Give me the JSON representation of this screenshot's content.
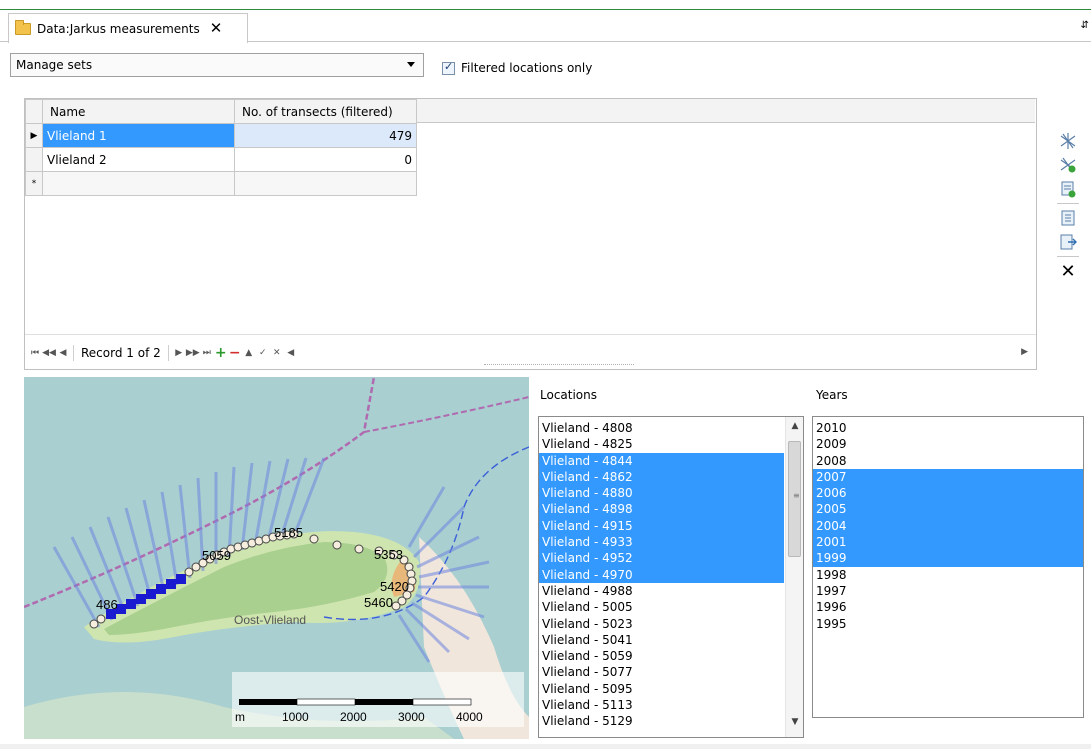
{
  "tab": {
    "title": "Data:Jarkus measurements",
    "close_icon": "close-icon"
  },
  "toolbar": {
    "combo_value": "Manage sets",
    "filter_checkbox_label": "Filtered locations only",
    "filter_checked": true
  },
  "grid": {
    "headers": [
      "Name",
      "No. of transects (filtered)"
    ],
    "rows": [
      {
        "name": "Vlieland 1",
        "count": "479",
        "selected": true
      },
      {
        "name": "Vlieland 2",
        "count": "0",
        "selected": false
      }
    ],
    "new_row_marker": "*",
    "current_row_marker": "▶"
  },
  "navigator": {
    "record_text": "Record 1 of 2"
  },
  "map": {
    "place_label": "Oost-Vlieland",
    "transect_labels": [
      "486",
      "5059",
      "5185",
      "5353",
      "5420",
      "5460"
    ],
    "scale": {
      "unit": "m",
      "ticks": [
        "1000",
        "2000",
        "3000",
        "4000"
      ]
    }
  },
  "locations": {
    "label": "Locations",
    "items": [
      "Vlieland - 4808",
      "Vlieland - 4825",
      "Vlieland - 4844",
      "Vlieland - 4862",
      "Vlieland - 4880",
      "Vlieland - 4898",
      "Vlieland - 4915",
      "Vlieland - 4933",
      "Vlieland - 4952",
      "Vlieland - 4970",
      "Vlieland - 4988",
      "Vlieland - 5005",
      "Vlieland - 5023",
      "Vlieland - 5041",
      "Vlieland - 5059",
      "Vlieland - 5077",
      "Vlieland - 5095",
      "Vlieland - 5113",
      "Vlieland - 5129"
    ],
    "selected": [
      2,
      3,
      4,
      5,
      6,
      7,
      8,
      9
    ]
  },
  "years": {
    "label": "Years",
    "items": [
      "2010",
      "2009",
      "2008",
      "2007",
      "2006",
      "2005",
      "2004",
      "2001",
      "1999",
      "1998",
      "1997",
      "1996",
      "1995"
    ],
    "selected": [
      3,
      4,
      5,
      6,
      7,
      8
    ]
  },
  "colors": {
    "selection": "#3399ff",
    "water": "#a9cfd0",
    "land": "#a9d08e",
    "transect": "#6f86e0"
  }
}
